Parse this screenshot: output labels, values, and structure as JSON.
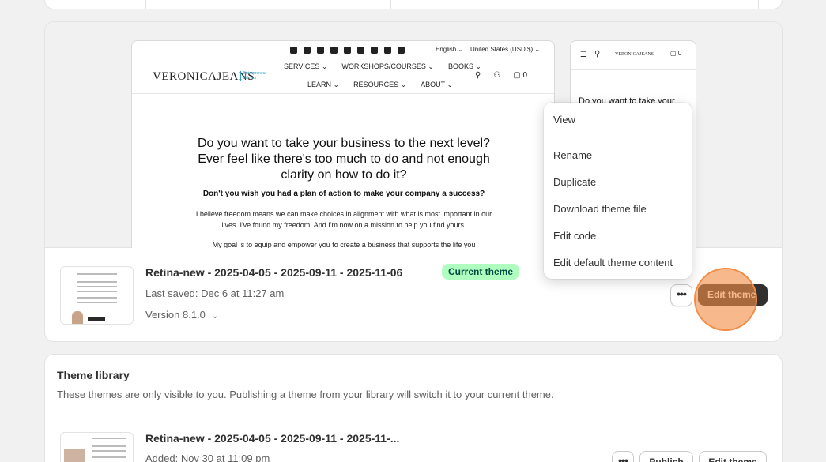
{
  "colors": {
    "page_bg": "#f1f1f1",
    "badge_bg": "#affebf",
    "badge_text": "#014b40",
    "primary_button": "#303030",
    "click_indicator": "#f28c46"
  },
  "preview": {
    "desktop": {
      "social_icons": [
        "mail-icon",
        "facebook-icon",
        "instagram-icon",
        "linkedin-icon",
        "medium-icon",
        "messenger-icon",
        "pinterest-icon",
        "x-icon",
        "youtube-icon"
      ],
      "language": "English ⌄",
      "currency": "United States (USD $) ⌄",
      "logo": "VERONICAJEANS",
      "logo_sub": "Entrepreneur Advisor",
      "nav_row1": [
        "SERVICES ⌄",
        "WORKSHOPS/COURSES ⌄",
        "BOOKS ⌄"
      ],
      "nav_row2": [
        "LEARN ⌄",
        "RESOURCES ⌄",
        "ABOUT ⌄"
      ],
      "cart_count": "0",
      "headline": "Do you want to take your business to the next level? Ever feel like there's too much to do and not enough clarity on how to do it?",
      "subhead": "Don't you wish you had a plan of action to make your company a success?",
      "body": "I believe freedom means we can make choices in alignment with what is most important in our lives. I've found my freedom. And I'm now on a mission to help you find yours.",
      "body2": "My goal is to equip and empower you to create a business that supports the life you"
    },
    "mobile": {
      "logo": "VERONICAJEANS",
      "cart_count": "0",
      "headline": "Do you want to take your"
    }
  },
  "current_theme": {
    "name": "Retina-new - 2025-04-05 - 2025-09-11 - 2025-11-06",
    "badge": "Current theme",
    "last_saved": "Last saved: Dec 6 at 11:27 am",
    "version": "Version 8.1.0",
    "more_label": "•••",
    "edit_label": "Edit theme"
  },
  "menu": {
    "items": [
      "View",
      "Rename",
      "Duplicate",
      "Download theme file",
      "Edit code",
      "Edit default theme content"
    ]
  },
  "library": {
    "title": "Theme library",
    "description": "These themes are only visible to you. Publishing a theme from your library will switch it to your current theme.",
    "item": {
      "name": "Retina-new - 2025-04-05 - 2025-09-11 - 2025-11-...",
      "added": "Added: Nov 30 at 11:09 pm",
      "more_label": "•••",
      "publish_label": "Publish",
      "edit_label": "Edit theme"
    }
  }
}
